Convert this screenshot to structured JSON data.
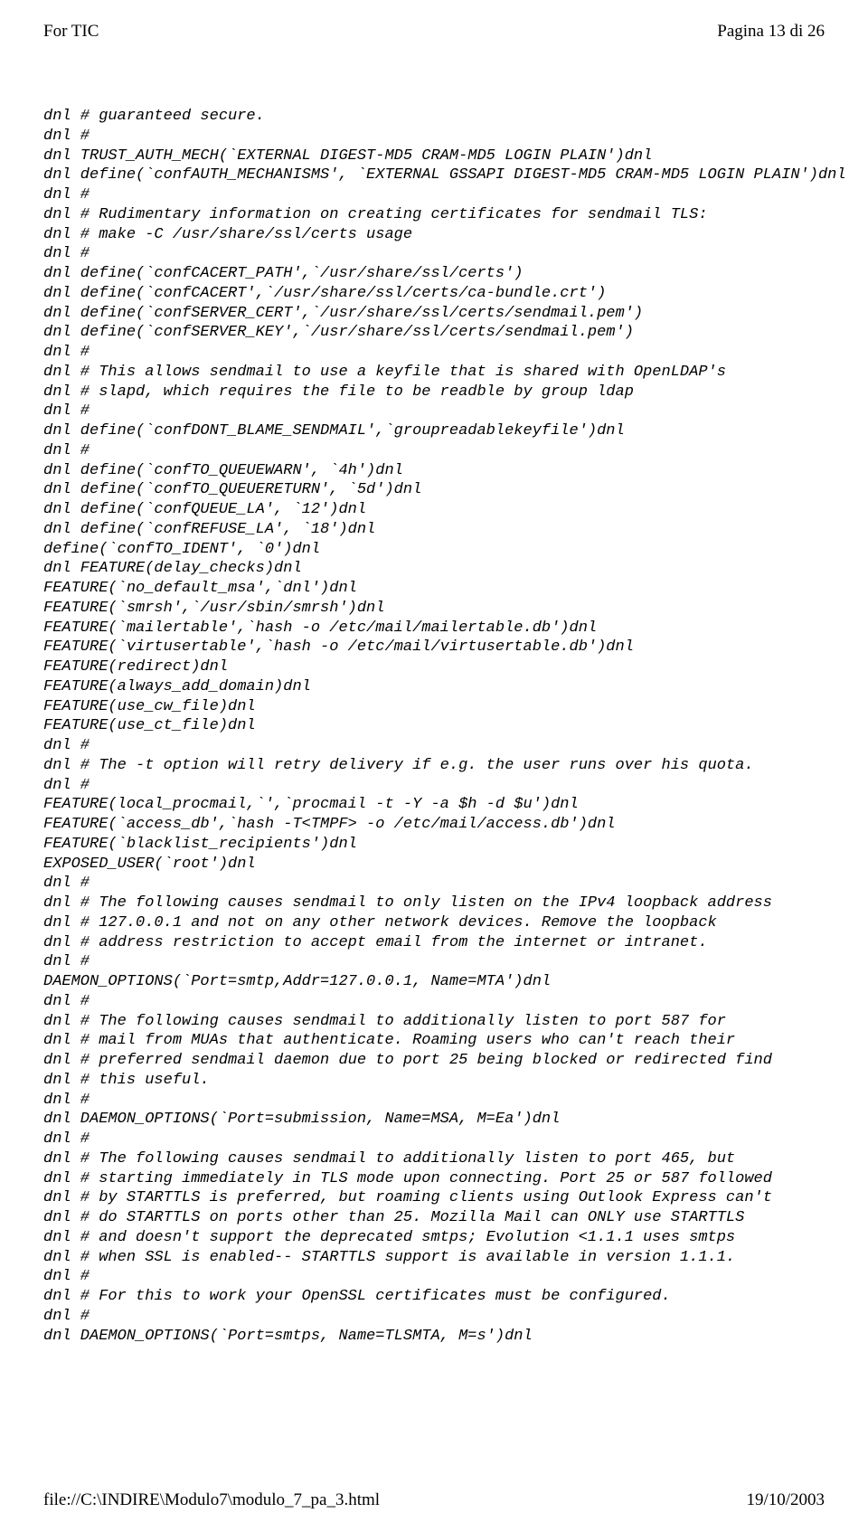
{
  "header": {
    "left": "For TIC",
    "right": "Pagina 13 di 26"
  },
  "code": "dnl # guaranteed secure.\ndnl #\ndnl TRUST_AUTH_MECH(`EXTERNAL DIGEST-MD5 CRAM-MD5 LOGIN PLAIN')dnl\ndnl define(`confAUTH_MECHANISMS', `EXTERNAL GSSAPI DIGEST-MD5 CRAM-MD5 LOGIN PLAIN')dnl\ndnl #\ndnl # Rudimentary information on creating certificates for sendmail TLS:\ndnl # make -C /usr/share/ssl/certs usage\ndnl #\ndnl define(`confCACERT_PATH',`/usr/share/ssl/certs')\ndnl define(`confCACERT',`/usr/share/ssl/certs/ca-bundle.crt')\ndnl define(`confSERVER_CERT',`/usr/share/ssl/certs/sendmail.pem')\ndnl define(`confSERVER_KEY',`/usr/share/ssl/certs/sendmail.pem')\ndnl #\ndnl # This allows sendmail to use a keyfile that is shared with OpenLDAP's\ndnl # slapd, which requires the file to be readble by group ldap\ndnl #\ndnl define(`confDONT_BLAME_SENDMAIL',`groupreadablekeyfile')dnl\ndnl #\ndnl define(`confTO_QUEUEWARN', `4h')dnl\ndnl define(`confTO_QUEUERETURN', `5d')dnl\ndnl define(`confQUEUE_LA', `12')dnl\ndnl define(`confREFUSE_LA', `18')dnl\ndefine(`confTO_IDENT', `0')dnl\ndnl FEATURE(delay_checks)dnl\nFEATURE(`no_default_msa',`dnl')dnl\nFEATURE(`smrsh',`/usr/sbin/smrsh')dnl\nFEATURE(`mailertable',`hash -o /etc/mail/mailertable.db')dnl\nFEATURE(`virtusertable',`hash -o /etc/mail/virtusertable.db')dnl\nFEATURE(redirect)dnl\nFEATURE(always_add_domain)dnl\nFEATURE(use_cw_file)dnl\nFEATURE(use_ct_file)dnl\ndnl #\ndnl # The -t option will retry delivery if e.g. the user runs over his quota.\ndnl #\nFEATURE(local_procmail,`',`procmail -t -Y -a $h -d $u')dnl\nFEATURE(`access_db',`hash -T<TMPF> -o /etc/mail/access.db')dnl\nFEATURE(`blacklist_recipients')dnl\nEXPOSED_USER(`root')dnl\ndnl #\ndnl # The following causes sendmail to only listen on the IPv4 loopback address\ndnl # 127.0.0.1 and not on any other network devices. Remove the loopback\ndnl # address restriction to accept email from the internet or intranet.\ndnl #\nDAEMON_OPTIONS(`Port=smtp,Addr=127.0.0.1, Name=MTA')dnl\ndnl #\ndnl # The following causes sendmail to additionally listen to port 587 for\ndnl # mail from MUAs that authenticate. Roaming users who can't reach their\ndnl # preferred sendmail daemon due to port 25 being blocked or redirected find\ndnl # this useful.\ndnl #\ndnl DAEMON_OPTIONS(`Port=submission, Name=MSA, M=Ea')dnl\ndnl #\ndnl # The following causes sendmail to additionally listen to port 465, but\ndnl # starting immediately in TLS mode upon connecting. Port 25 or 587 followed\ndnl # by STARTTLS is preferred, but roaming clients using Outlook Express can't\ndnl # do STARTTLS on ports other than 25. Mozilla Mail can ONLY use STARTTLS\ndnl # and doesn't support the deprecated smtps; Evolution <1.1.1 uses smtps\ndnl # when SSL is enabled-- STARTTLS support is available in version 1.1.1.\ndnl #\ndnl # For this to work your OpenSSL certificates must be configured.\ndnl #\ndnl DAEMON_OPTIONS(`Port=smtps, Name=TLSMTA, M=s')dnl",
  "footer": {
    "left": "file://C:\\INDIRE\\Modulo7\\modulo_7_pa_3.html",
    "right": "19/10/2003"
  }
}
